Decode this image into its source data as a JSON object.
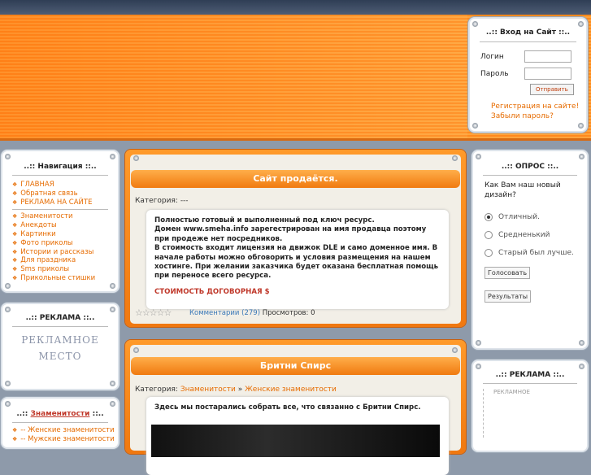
{
  "login": {
    "title": "..:: Вход на Сайт ::..",
    "login_label": "Логин",
    "password_label": "Пароль",
    "submit_label": "Отправить",
    "register_link": "Регистрация на сайте!",
    "forgot_link": "Забыли пароль?"
  },
  "navigation": {
    "title": "..:: Навигация ::..",
    "group1": [
      "ГЛАВНАЯ",
      "Обратная связь",
      "РЕКЛАМА НА САЙТЕ"
    ],
    "group2": [
      "Знаменитости",
      "Анекдоты",
      "Картинки",
      "Фото приколы",
      "Истории и рассказы",
      "Для праздника",
      "Sms приколы",
      "Прикольные стишки"
    ]
  },
  "ad_left": {
    "title": "..:: РЕКЛАМА ::..",
    "image_text_line1": "РЕКЛАМНОЕ",
    "image_text_line2": "МЕСТО"
  },
  "celebs": {
    "title_prefix": "..::",
    "title_highlight": "Знаменитости",
    "title_suffix": "::..",
    "items": [
      "-- Женские знаменитости",
      "-- Мужские знаменитости"
    ]
  },
  "article1": {
    "title": "Сайт продаётся.",
    "category_label": "Категория:",
    "category_value": "---",
    "body_line1": "Полностью готовый и выполненный под ключ ресурс.",
    "body_line2": "Домен www.smeha.info зарегестрирован на имя продавца поэтому при продеже нет посредников.",
    "body_line3": "В стоимость входит лицензия на движок DLE и само доменное имя. В начале работы можно обговорить и условия размещения на нашем хостинге. При желании заказчика будет оказана бесплатная помощь при переносе всего ресурса.",
    "price": "СТОИМОСТЬ ДОГОВОРНАЯ $",
    "comments_link": "Комментарии (279)",
    "views_label": "Просмотров:",
    "views_value": "0"
  },
  "article2": {
    "title": "Бритни Спирс",
    "category_label": "Категория:",
    "category_link1": "Знаменитости",
    "category_sep": "»",
    "category_link2": "Женские знаменитости",
    "body": "Здесь мы постарались собрать все, что связанно с Бритни Спирс."
  },
  "poll": {
    "title": "..:: ОПРОС ::..",
    "question": "Как Вам наш новый дизайн?",
    "options": [
      "Отличный.",
      "Средненький",
      "Старый был лучше."
    ],
    "selected_index": 0,
    "vote_label": "Голосовать",
    "results_label": "Результаты"
  },
  "ad_right": {
    "title": "..:: РЕКЛАМА ::..",
    "image_text": "РЕКЛАМНОЕ"
  }
}
